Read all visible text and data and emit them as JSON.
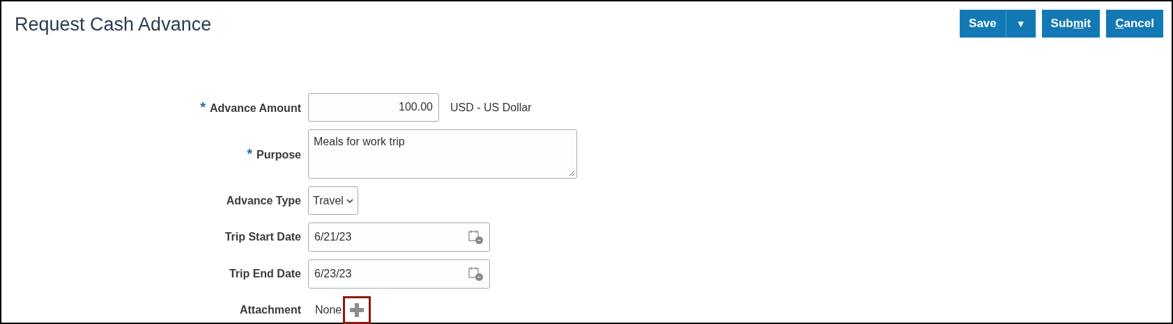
{
  "title": "Request Cash Advance",
  "buttons": [
    {
      "kind": "split",
      "label": "Save",
      "menu_glyph": "▼"
    },
    {
      "kind": "access",
      "before": "Sub",
      "key": "m",
      "after": "it"
    },
    {
      "kind": "access",
      "key": "C",
      "after": "ancel"
    }
  ],
  "fields": [
    {
      "kind": "amount",
      "label": "Advance Amount",
      "required": true,
      "value": "100.00",
      "suffix": "USD - US Dollar"
    },
    {
      "kind": "textarea",
      "label": "Purpose",
      "required": true,
      "value": "Meals for work trip"
    },
    {
      "kind": "select",
      "label": "Advance Type",
      "required": false,
      "value": "Travel"
    },
    {
      "kind": "date",
      "label": "Trip Start Date",
      "required": false,
      "value": "6/21/23"
    },
    {
      "kind": "date",
      "label": "Trip End Date",
      "required": false,
      "value": "6/23/23"
    },
    {
      "kind": "attachment",
      "label": "Attachment",
      "required": false,
      "value": "None",
      "highlighted": true
    }
  ],
  "required_mark": "*"
}
